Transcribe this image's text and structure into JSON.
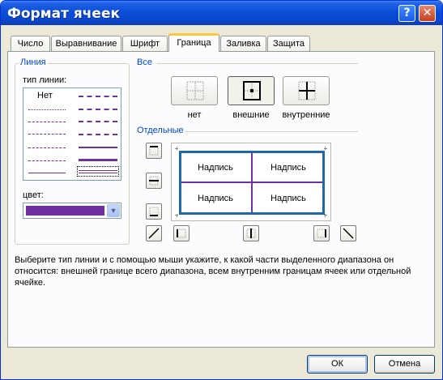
{
  "window": {
    "title": "Формат ячеек"
  },
  "title_buttons": {
    "help": "?",
    "close": "✕"
  },
  "tabs": [
    {
      "label": "Число",
      "active": false
    },
    {
      "label": "Выравнивание",
      "active": false
    },
    {
      "label": "Шрифт",
      "active": false
    },
    {
      "label": "Граница",
      "active": true
    },
    {
      "label": "Заливка",
      "active": false
    },
    {
      "label": "Защита",
      "active": false
    }
  ],
  "line_group": {
    "title": "Линия",
    "style_label": "тип линии:",
    "none_label": "Нет",
    "color_label": "цвет:",
    "selected_color": "#7030a0"
  },
  "presets": {
    "title": "Все",
    "buttons": [
      {
        "label": "нет",
        "icon": "border-none-icon"
      },
      {
        "label": "внешние",
        "icon": "border-outline-icon"
      },
      {
        "label": "внутренние",
        "icon": "border-inside-icon"
      }
    ]
  },
  "individual": {
    "title": "Отдельные",
    "preview_cells": [
      "Надпись",
      "Надпись",
      "Надпись",
      "Надпись"
    ],
    "outer_border_color": "#1e6aa8",
    "inner_border_color": "#7030a0"
  },
  "description": "Выберите тип линии и с помощью мыши укажите, к какой части выделенного диапазона он относится: внешней границе всего диапазона, всем внутренним границам ячеек или отдельной ячейке.",
  "buttons": {
    "ok": "ОК",
    "cancel": "Отмена"
  }
}
